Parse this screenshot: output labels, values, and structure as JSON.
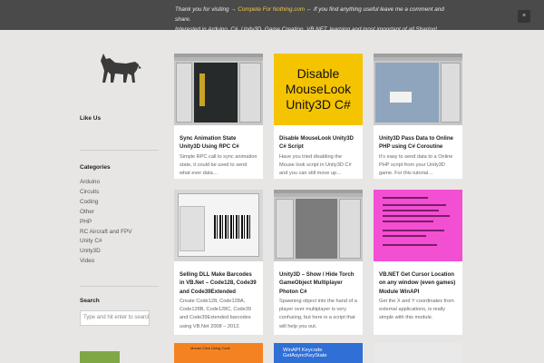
{
  "notice": {
    "prefix": "Thank you for visiting →",
    "link": "Compete For Nothing.com",
    "suffix": "← If you find anything useful leave me a comment and share.",
    "line2": "Interested in Arduino, C#, Unity3D, Game Creation, VB.NET, learning and most important of all Sharing!.",
    "close_label": "×"
  },
  "logo": {
    "icon": "wolf-logo"
  },
  "sidebar": {
    "like_us": "Like Us",
    "categories_title": "Categories",
    "categories": [
      "Arduino",
      "Circuits",
      "Coding",
      "Other",
      "PHP",
      "RC Aircraft and FPV",
      "Unity C#",
      "Unity3D",
      "Video"
    ],
    "search_title": "Search",
    "search_placeholder": "Type and hit enter to search"
  },
  "posts": [
    {
      "title": "Sync Animation State Unity3D Using RPC C#",
      "excerpt": "Simple RPC  call to sync animation state, it could be used to send what ever data…"
    },
    {
      "thumb_text": "Disable\nMouseLook\nUnity3D   C#",
      "thumb_color": "#f5c400",
      "title": "Disable MouseLook Unity3D C# Script",
      "excerpt": "Have you tried disabling the Mouse look script in Unity3D C# and you can still move up…"
    },
    {
      "title": "Unity3D Pass Data to Online PHP using C# Coroutine",
      "excerpt": "It’s easy to send data to a Online PHP script from your Unity3D game. For this tutorial…"
    },
    {
      "title": "Selling DLL Make Barcodes in VB.Net – Code128, Code39 and Code39Extended",
      "excerpt": "Create Code128, Code128A, Code128B, Code128C, Code39 and Code39Extended barcodes using VB.Net 2008 – 2012."
    },
    {
      "title": "Unity3D – Show / Hide Torch GameObject Multiplayer Photon C#",
      "excerpt": "Spawning object into the hand of a player over multiplayer is very confusing, but here is a script that will help you out."
    },
    {
      "thumb_color": "#f24fd2",
      "title": "VB.NET Get Cursor Location on any window (even games) Module WinAPI",
      "excerpt": "Get the X and Y coordinates from external applications, is really simple with this module."
    },
    {
      "thumb_color": "#f58220",
      "thumb_caption": "Mouse Click Using Code"
    },
    {
      "thumb_color": "#2f6fd6",
      "thumb_caption": "WinAPI Keycode GetAsyncKeyState"
    },
    {
      "thumb_color": "#e9e9e9"
    }
  ]
}
